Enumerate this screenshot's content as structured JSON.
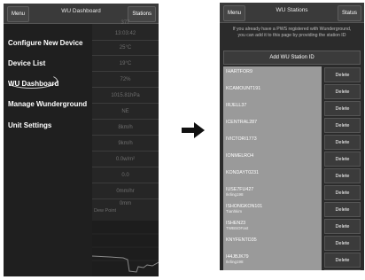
{
  "left_screen": {
    "topbar": {
      "menu_label": "Menu",
      "title": "WU Dashboard",
      "stations_label": "Stations"
    },
    "dashboard_values": [
      "377",
      "13:03:42",
      "25°C",
      "19°C",
      "72%",
      "1015.81hPa",
      "NE",
      "8km/h",
      "9km/h",
      "0.0w/m²",
      "0.0",
      "0mm/hr",
      "0mm"
    ],
    "dew_point_label": "Dew Point",
    "drawer_items": [
      "Configure New Device",
      "Device List",
      "WU Dashboard",
      "Manage Wunderground",
      "Unit Settings"
    ]
  },
  "right_screen": {
    "topbar": {
      "menu_label": "Menu",
      "title": "WU Stations",
      "status_label": "Status"
    },
    "info_lines": [
      "If you already have a PWS registered with Wunderground,",
      "you can add it to this page by providing the station ID"
    ],
    "add_button_label": "Add WU Station ID",
    "delete_label": "Delete",
    "stations": [
      {
        "id": "IHARTFOR9",
        "sub": ""
      },
      {
        "id": "KCAMOUNT191",
        "sub": ""
      },
      {
        "id": "IRJELL37",
        "sub": ""
      },
      {
        "id": "ICENTRAL287",
        "sub": ""
      },
      {
        "id": "IVICTORI1773",
        "sub": ""
      },
      {
        "id": "IONMELRO4",
        "sub": ""
      },
      {
        "id": "KONDAYT0231",
        "sub": ""
      },
      {
        "id": "IUSE7FU427",
        "sub": "Ikrling198"
      },
      {
        "id": "ISHONGKON101",
        "sub": "Tianhkim"
      },
      {
        "id": "ISHEN23",
        "sub": "TWBSOFast"
      },
      {
        "id": "KNYFENTO35",
        "sub": ""
      },
      {
        "id": "I44JBJK79",
        "sub": "Ikrling198"
      },
      {
        "id": "IUSE7FU426",
        "sub": ""
      }
    ]
  }
}
